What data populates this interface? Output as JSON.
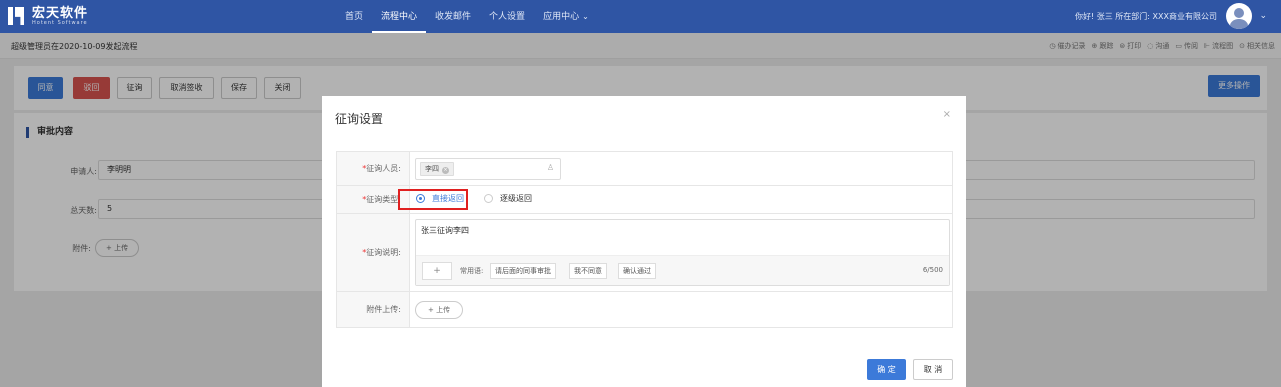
{
  "brand": {
    "name_cn": "宏天软件",
    "name_en": "Hotent Software"
  },
  "nav": [
    {
      "label": "首页"
    },
    {
      "label": "流程中心"
    },
    {
      "label": "收发邮件"
    },
    {
      "label": "个人设置"
    },
    {
      "label": "应用中心"
    }
  ],
  "user": {
    "greeting": "你好! 张三 所在部门: XXX商业有限公司"
  },
  "subheader": {
    "flow_title": "超级管理员在2020-10-09发起流程",
    "links": [
      {
        "icon": "clock-icon",
        "glyph": "◷",
        "label": "催办记录"
      },
      {
        "icon": "track-icon",
        "glyph": "⊕",
        "label": "跟踪"
      },
      {
        "icon": "print-icon",
        "glyph": "⊜",
        "label": "打印"
      },
      {
        "icon": "chat-icon",
        "glyph": "◌",
        "label": "沟通"
      },
      {
        "icon": "cc-icon",
        "glyph": "▭",
        "label": "传阅"
      },
      {
        "icon": "flowchart-icon",
        "glyph": "⊩",
        "label": "流程图"
      },
      {
        "icon": "info-icon",
        "glyph": "⊙",
        "label": "相关信息"
      }
    ]
  },
  "actions": {
    "agree": "同意",
    "reject": "驳回",
    "consult": "征询",
    "cancel_sign": "取消签收",
    "save": "保存",
    "close": "关闭",
    "more": "更多操作"
  },
  "content": {
    "section_title": "审批内容",
    "applicant_label": "申请人:",
    "applicant_value": "李明明",
    "days_label": "总天数:",
    "days_value": "5",
    "attachment_label": "附件:",
    "upload_label": "+ 上传"
  },
  "modal": {
    "title": "征询设置",
    "close_glyph": "×",
    "person_label": "征询人员:",
    "person_tag": "李四",
    "type_label": "征询类型:",
    "type_options": [
      {
        "label": "直接返回",
        "selected": true
      },
      {
        "label": "逐级返回",
        "selected": false
      }
    ],
    "desc_label": "征询说明:",
    "desc_value": "张三征询李四",
    "phrases_label": "常用语:",
    "phrases": [
      "请后面的同事审批",
      "我不同意",
      "确认通过"
    ],
    "counter": "6/500",
    "attach_label": "附件上传:",
    "upload_label": "+ 上传",
    "ok": "确 定",
    "cancel": "取 消"
  },
  "colors": {
    "header_bg": "#2f55a4",
    "primary": "#3c7ad9",
    "danger": "#d9534f",
    "highlight": "#e02020"
  }
}
